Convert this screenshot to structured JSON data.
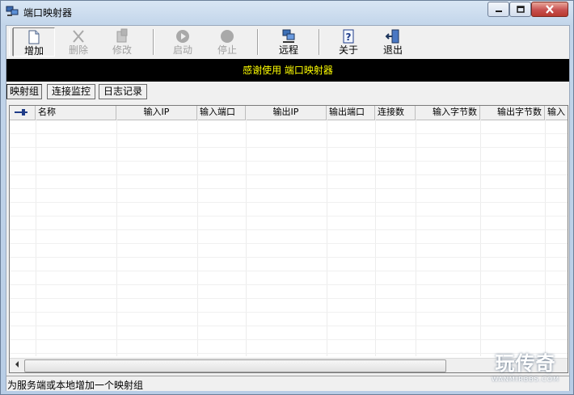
{
  "window": {
    "title": "端口映射器"
  },
  "toolbar": {
    "add": "增加",
    "delete": "删除",
    "modify": "修改",
    "start": "启动",
    "stop": "停止",
    "remote": "远程",
    "about": "关于",
    "exit": "退出"
  },
  "banner": {
    "text": "感谢使用 端口映射器"
  },
  "tabs": [
    {
      "label": "映射组",
      "active": true
    },
    {
      "label": "连接监控",
      "active": false
    },
    {
      "label": "日志记录",
      "active": false
    }
  ],
  "table": {
    "columns": [
      "名称",
      "输入IP",
      "输入端口",
      "输出IP",
      "输出端口",
      "连接数",
      "输入字节数",
      "输出字节数",
      "输入"
    ],
    "rows": []
  },
  "status": {
    "text": "为服务端或本地增加一个映射组"
  },
  "watermark": {
    "title": "玩传奇",
    "subtitle": "WANMIRBBS.COM"
  },
  "colors": {
    "banner_bg": "#000000",
    "banner_text": "#ffff00",
    "close_button": "#c75050"
  }
}
